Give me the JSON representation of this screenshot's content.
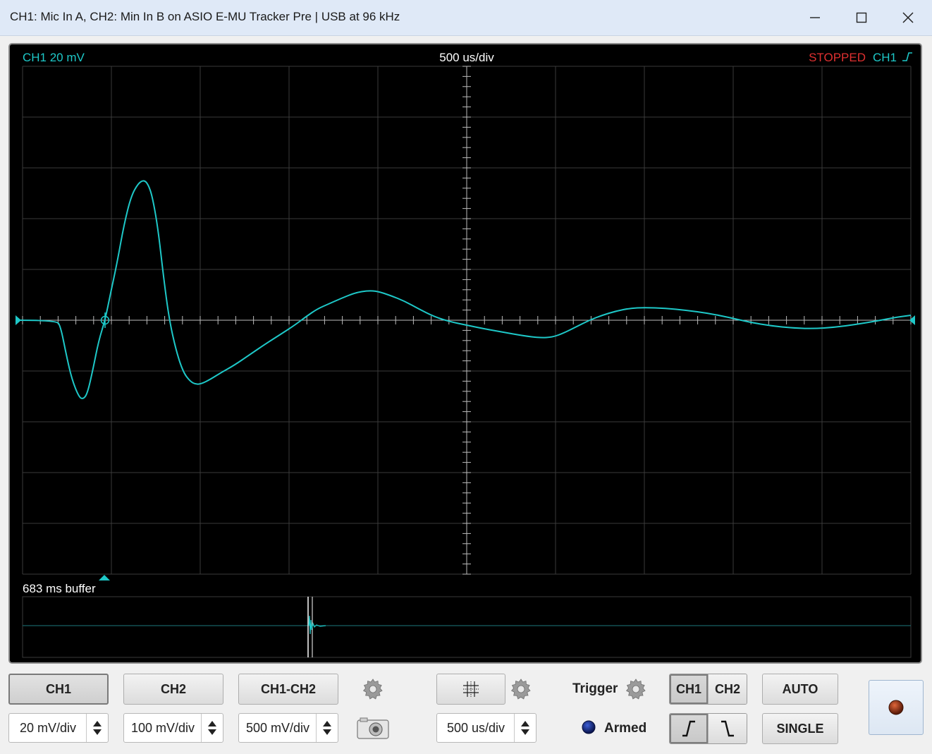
{
  "window": {
    "title": "CH1: Mic In A, CH2: Min In B on ASIO E-MU Tracker Pre | USB at 96 kHz"
  },
  "scope": {
    "channel_label": "CH1 20 mV",
    "timebase_label": "500 us/div",
    "status": "STOPPED",
    "trigger_label": "CH1",
    "buffer_label": "683 ms buffer",
    "colors": {
      "trace": "#1ec8c8",
      "status": "#e03030",
      "grid": "#3a3a3a",
      "background": "#000000"
    }
  },
  "controls": {
    "ch1_button": "CH1",
    "ch2_button": "CH2",
    "diff_button": "CH1-CH2",
    "ch1_scale": "20 mV/div",
    "ch2_scale": "100 mV/div",
    "diff_scale": "500 mV/div",
    "timebase": "500 us/div",
    "trigger_label": "Trigger",
    "armed_label": "Armed",
    "trig_ch1": "CH1",
    "trig_ch2": "CH2",
    "auto_button": "AUTO",
    "single_button": "SINGLE"
  }
}
